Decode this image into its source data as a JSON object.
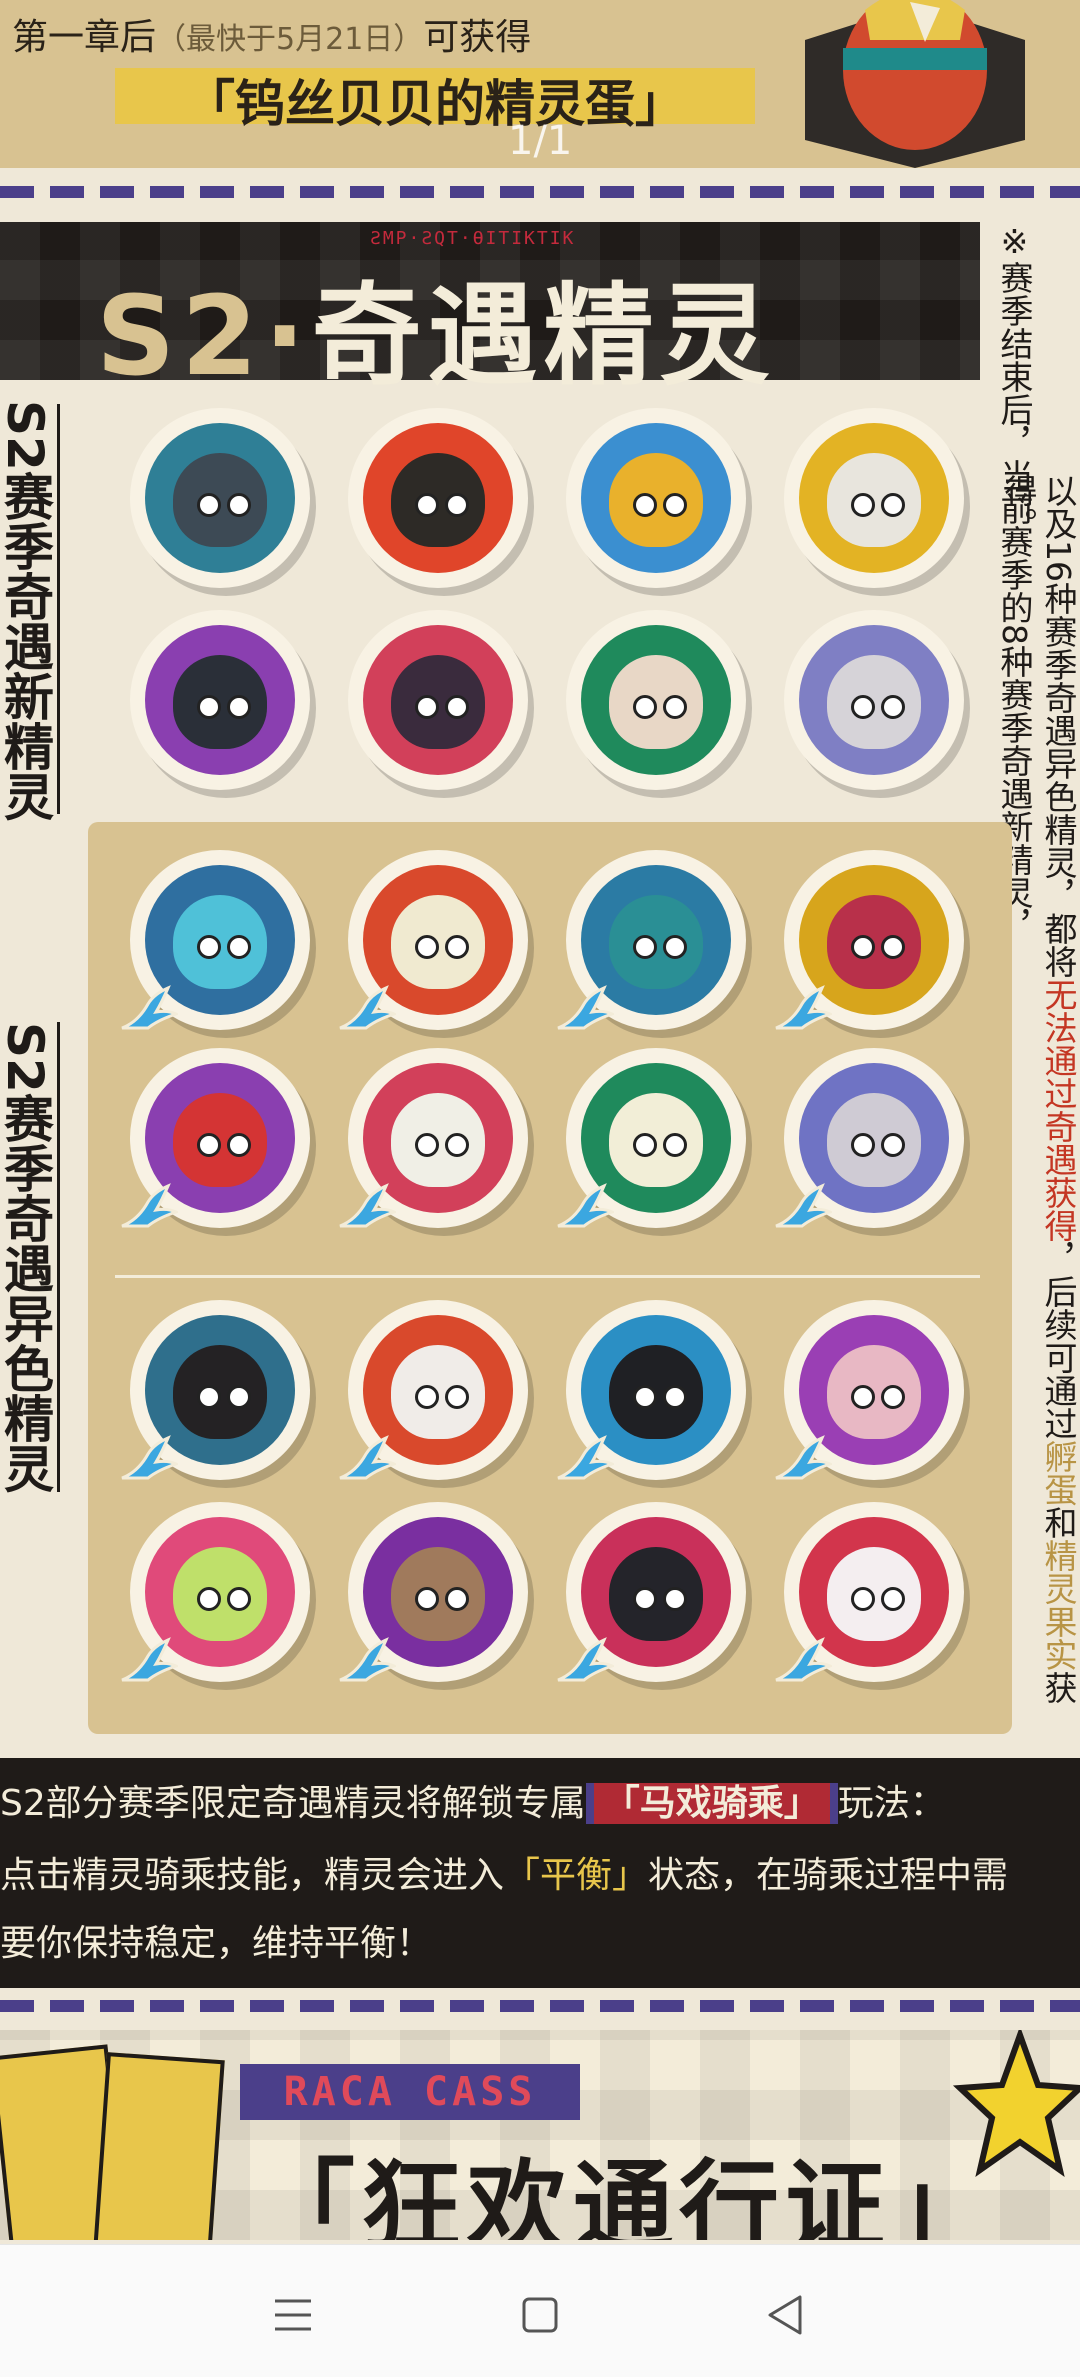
{
  "header": {
    "line1_prefix": "第一章后",
    "line1_hint": "（最快于5月21日）",
    "line1_suffix": "可获得",
    "reward_title": "「钨丝贝贝的精灵蛋」",
    "page_indicator": "1/1"
  },
  "section": {
    "runes": "ƧMP·ƧQT·ƟITIKTIK",
    "title_prefix": "S2·",
    "title_main": "奇遇精灵",
    "label_new": "S2赛季奇遇新精灵",
    "label_shiny": "S2赛季奇遇异色精灵"
  },
  "note": {
    "col1": "※赛季结束后，当前赛季的8种赛季奇遇新精灵，",
    "col2_a": "以及16种赛季奇遇异色精灵，都将",
    "col2_red": "无法通过奇遇获得",
    "col2_b": "，后续可通过",
    "col2_gold1": "孵蛋",
    "col2_c": "和",
    "col2_gold2": "精灵果实",
    "col2_d": "获得。"
  },
  "creatures": {
    "new": [
      {
        "name": "teal-hood-penguin",
        "bg": "#2f7f96",
        "body": "#3d4a55"
      },
      {
        "name": "pumpkin-flame",
        "bg": "#e0452a",
        "body": "#2d2a26"
      },
      {
        "name": "yellow-hood-mask",
        "bg": "#3b8fd0",
        "body": "#e9b12c"
      },
      {
        "name": "badger-mask",
        "bg": "#e3b324",
        "body": "#e8e5dd"
      },
      {
        "name": "bottle-bowtie",
        "bg": "#8a3fb0",
        "body": "#2a2f38"
      },
      {
        "name": "jester-ball",
        "bg": "#d2405a",
        "body": "#3a2b3d"
      },
      {
        "name": "clock-robot",
        "bg": "#1f8a5c",
        "body": "#e8d7c6"
      },
      {
        "name": "hat-robot",
        "bg": "#7f7fc4",
        "body": "#d6d3d8"
      }
    ],
    "shiny": [
      {
        "name": "sky-hood-penguin",
        "bg": "#2f6fa0",
        "body": "#4fc1d8"
      },
      {
        "name": "crystal-flame",
        "bg": "#d9492c",
        "body": "#f0ead0"
      },
      {
        "name": "teal-hood-mask",
        "bg": "#2b7ba4",
        "body": "#2a8f95"
      },
      {
        "name": "red-badger",
        "bg": "#d7a51c",
        "body": "#b8304a"
      },
      {
        "name": "red-bottle",
        "bg": "#8a3fb0",
        "body": "#d43434"
      },
      {
        "name": "pale-jester",
        "bg": "#d2405a",
        "body": "#f0efe6"
      },
      {
        "name": "pale-clock-robot",
        "bg": "#1f8a5c",
        "body": "#f2eed7"
      },
      {
        "name": "purple-hat-robot",
        "bg": "#6f73c4",
        "body": "#cfcbd4"
      },
      {
        "name": "red-bow-penguin",
        "bg": "#2f6f8c",
        "body": "#242224"
      },
      {
        "name": "white-fox-mask",
        "bg": "#d9492c",
        "body": "#f0ece8"
      },
      {
        "name": "crimson-horse",
        "bg": "#2b8fc4",
        "body": "#1f2024"
      },
      {
        "name": "pink-kettle",
        "bg": "#9a3fb4",
        "body": "#e8b8c4"
      },
      {
        "name": "lime-sprout",
        "bg": "#e04a7a",
        "body": "#bfe06a"
      },
      {
        "name": "stone-shell",
        "bg": "#7a2fa0",
        "body": "#a07a5c"
      },
      {
        "name": "black-cat",
        "bg": "#c9305a",
        "body": "#24242a"
      },
      {
        "name": "white-cat",
        "bg": "#d2354c",
        "body": "#f4eef0"
      }
    ]
  },
  "info": {
    "line1_a": "S2部分赛季限定奇遇精灵将解锁专属",
    "line1_mode": "「马戏骑乘」",
    "line1_b": "玩法：",
    "line2_a": "点击精灵骑乘技能，精灵会进入",
    "line2_state": "「平衡」",
    "line2_b": "状态，在骑乘过程中需",
    "line3": "要你保持稳定，维持平衡！"
  },
  "pass": {
    "tag": "RACA CASS",
    "title": "「狂欢通行证」"
  },
  "colors": {
    "accent_purple": "#4b3f8a",
    "highlight_red": "#c43623",
    "gold": "#b89445",
    "yellow": "#e8c64b"
  },
  "navbar": {
    "menu_icon": "menu-icon",
    "home_icon": "home-icon",
    "back_icon": "back-icon"
  }
}
